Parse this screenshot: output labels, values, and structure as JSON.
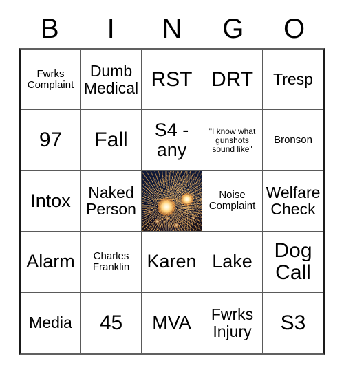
{
  "card": {
    "header_letters": [
      "B",
      "I",
      "N",
      "G",
      "O"
    ],
    "free_space": {
      "label": "fireworks-free-space",
      "alt_text": "Fireworks bursting in a dark night sky",
      "sky_color": "#0d1530",
      "burst_color": "#ffba5c",
      "core_color": "#fffdf4"
    },
    "grid_line_color": "#5a5a5a",
    "background_color": "#ffffff",
    "text_color": "#000000",
    "rows": [
      [
        {
          "text": "Fwrks Complaint",
          "size": "sm"
        },
        {
          "text": "Dumb Medical",
          "size": "md"
        },
        {
          "text": "RST",
          "size": "xl"
        },
        {
          "text": "DRT",
          "size": "xl"
        },
        {
          "text": "Tresp",
          "size": "md"
        }
      ],
      [
        {
          "text": "97",
          "size": "xl"
        },
        {
          "text": "Fall",
          "size": "xl"
        },
        {
          "text": "S4 - any",
          "size": "lg"
        },
        {
          "text": "\"I know what gunshots sound like\"",
          "size": "xs"
        },
        {
          "text": "Bronson",
          "size": "sm"
        }
      ],
      [
        {
          "text": "Intox",
          "size": "lg"
        },
        {
          "text": "Naked Person",
          "size": "md"
        },
        {
          "text": "",
          "size": "free"
        },
        {
          "text": "Noise Complaint",
          "size": "sm"
        },
        {
          "text": "Welfare Check",
          "size": "md"
        }
      ],
      [
        {
          "text": "Alarm",
          "size": "lg"
        },
        {
          "text": "Charles Franklin",
          "size": "sm"
        },
        {
          "text": "Karen",
          "size": "lg"
        },
        {
          "text": "Lake",
          "size": "lg"
        },
        {
          "text": "Dog Call",
          "size": "xl"
        }
      ],
      [
        {
          "text": "Media",
          "size": "md"
        },
        {
          "text": "45",
          "size": "xl"
        },
        {
          "text": "MVA",
          "size": "lg"
        },
        {
          "text": "Fwrks Injury",
          "size": "md"
        },
        {
          "text": "S3",
          "size": "xl"
        }
      ]
    ]
  }
}
